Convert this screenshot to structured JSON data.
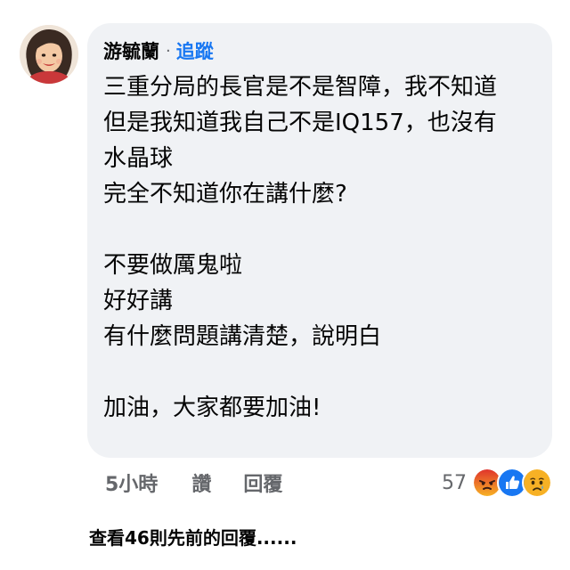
{
  "comment": {
    "author": "游毓蘭",
    "separator": "·",
    "follow_label": "追蹤",
    "lines": [
      "三重分局的長官是不是智障，我不知道",
      "但是我知道我自己不是IQ157，也沒有",
      "水晶球",
      "完全不知道你在講什麼?",
      "",
      "不要做厲鬼啦",
      "好好講",
      "有什麼問題講清楚，說明白",
      "",
      "加油，大家都要加油!"
    ]
  },
  "actions": {
    "time": "5小時",
    "like_label": "讚",
    "reply_label": "回覆"
  },
  "reactions": {
    "count": "57",
    "icons": [
      "angry-icon",
      "like-icon",
      "sad-icon"
    ],
    "colors": {
      "angry": "#e9710f",
      "like": "#1877f2",
      "sad": "#f7b125"
    }
  },
  "view_more": "查看46則先前的回覆......",
  "colors": {
    "bubble": "#f0f2f5",
    "link": "#1877f2",
    "muted": "#65676b",
    "text": "#050505"
  }
}
